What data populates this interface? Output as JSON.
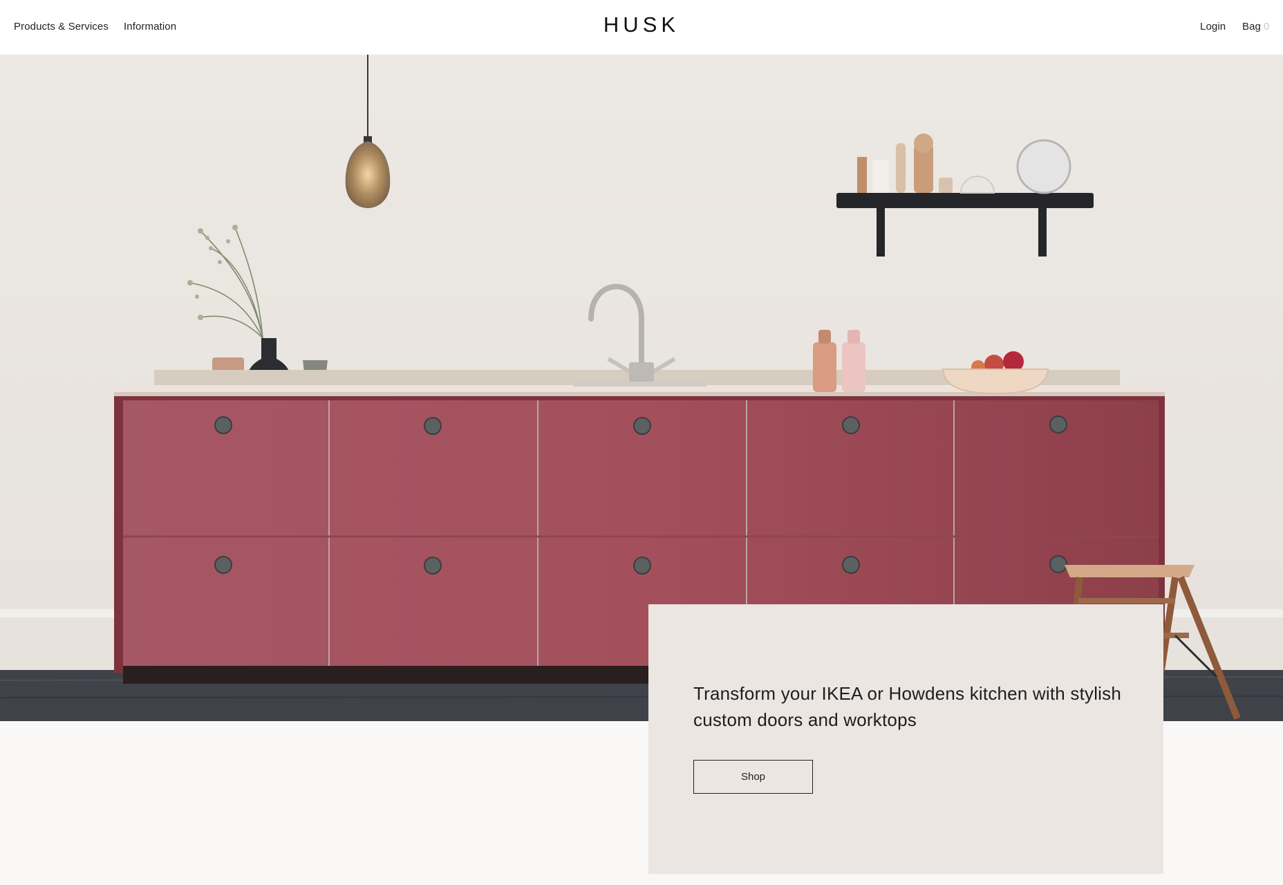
{
  "header": {
    "nav": {
      "products_services": "Products & Services",
      "information": "Information"
    },
    "logo": "HUSK",
    "login": "Login",
    "bag_label": "Bag",
    "bag_count": "0"
  },
  "hero": {
    "headline": "Transform your IKEA or Howdens kitchen with stylish custom doors and worktops",
    "shop_label": "Shop"
  },
  "colors": {
    "cabinet": "#a4505c",
    "wall": "#ebe6e1",
    "card": "#ebe6e2"
  }
}
